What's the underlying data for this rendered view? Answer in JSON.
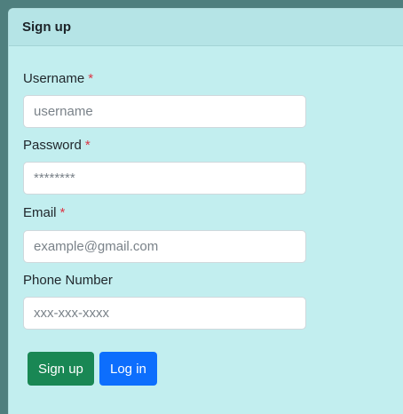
{
  "form": {
    "title": "Sign up",
    "required_marker": "*",
    "fields": {
      "username": {
        "label": "Username",
        "placeholder": "username",
        "required": true
      },
      "password": {
        "label": "Password",
        "placeholder": "********",
        "required": true
      },
      "email": {
        "label": "Email",
        "placeholder": "example@gmail.com",
        "required": true
      },
      "phone": {
        "label": "Phone Number",
        "placeholder": "xxx-xxx-xxxx",
        "required": false
      }
    },
    "buttons": {
      "signup": "Sign up",
      "login": "Log in"
    }
  },
  "colors": {
    "card_bg": "#c2eeef",
    "header_bg": "#b5e4e6",
    "backdrop": "#4f7f7e",
    "signup_button": "#198754",
    "login_button": "#0d6efd",
    "required_marker": "#dc3545"
  }
}
